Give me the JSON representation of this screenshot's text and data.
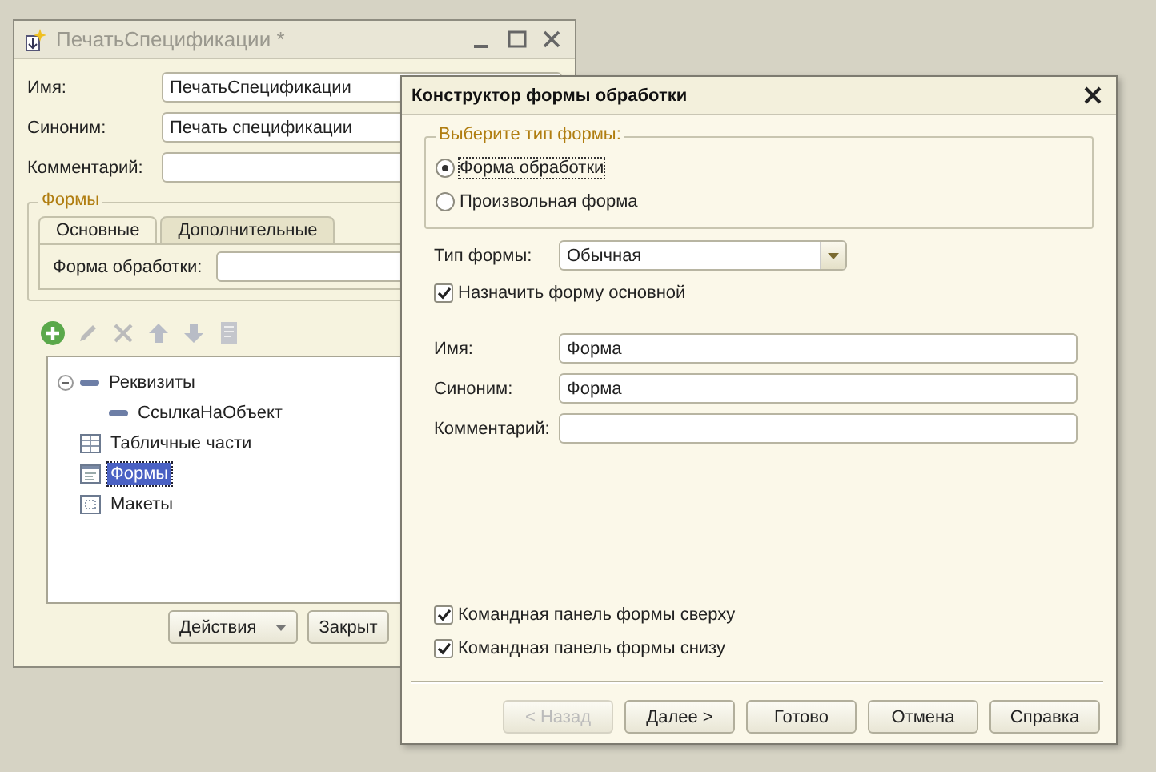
{
  "back_window": {
    "title": "ПечатьСпецификации *",
    "active": false,
    "fields": [
      {
        "label": "Имя:",
        "value": "ПечатьСпецификации"
      },
      {
        "label": "Синоним:",
        "value": "Печать спецификации"
      },
      {
        "label": "Комментарий:"
      }
    ],
    "forms_group": {
      "title": "Формы",
      "tabs": [
        {
          "label": "Основные",
          "selected": true
        },
        {
          "label": "Дополнительные",
          "selected": false
        }
      ],
      "field": {
        "label": "Форма обработки:"
      }
    },
    "tree": {
      "items": [
        {
          "label": "Реквизиты",
          "kind": "attributes",
          "expanded": true,
          "selected": false,
          "children": [
            {
              "label": "СсылкаНаОбъект",
              "kind": "attribute",
              "selected": false
            }
          ]
        },
        {
          "label": "Табличные части",
          "kind": "tables",
          "selected": false
        },
        {
          "label": "Формы",
          "kind": "forms",
          "selected": true
        },
        {
          "label": "Макеты",
          "kind": "layouts",
          "selected": false
        }
      ]
    },
    "buttons": [
      {
        "label": "Действия",
        "kind": "menu"
      },
      {
        "label": "Закрыт",
        "kind": "plain"
      }
    ]
  },
  "dialog": {
    "title": "Конструктор формы обработки",
    "active": true,
    "form_type_group": {
      "title": "Выберите тип формы:",
      "options": [
        {
          "label": "Форма обработки",
          "selected": true
        },
        {
          "label": "Произвольная форма",
          "selected": false
        }
      ]
    },
    "form_kind": {
      "label": "Тип формы:",
      "value": "Обычная"
    },
    "set_main": {
      "label": "Назначить форму основной",
      "checked": true
    },
    "fields": [
      {
        "label": "Имя:",
        "value": "Форма"
      },
      {
        "label": "Синоним:",
        "value": "Форма"
      },
      {
        "label": "Комментарий:"
      }
    ],
    "panel_options": [
      {
        "label": "Командная панель формы сверху",
        "checked": true
      },
      {
        "label": "Командная панель формы снизу",
        "checked": true
      }
    ],
    "buttons": [
      {
        "label": "< Назад",
        "disabled": true
      },
      {
        "label": "Далее >",
        "disabled": false
      },
      {
        "label": "Готово",
        "disabled": false
      },
      {
        "label": "Отмена",
        "disabled": false
      },
      {
        "label": "Справка",
        "disabled": false
      }
    ]
  }
}
